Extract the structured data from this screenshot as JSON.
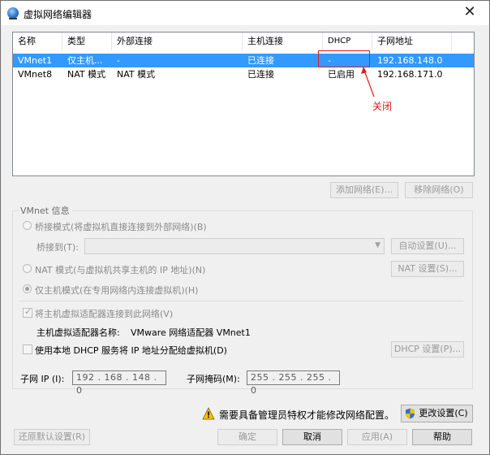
{
  "window": {
    "title": "虚拟网络编辑器",
    "close_glyph": "✕"
  },
  "table": {
    "headers": [
      "名称",
      "类型",
      "外部连接",
      "主机连接",
      "DHCP",
      "子网地址"
    ],
    "rows": [
      [
        "VMnet1",
        "仅主机...",
        "-",
        "已连接",
        "-",
        "192.168.148.0"
      ],
      [
        "VMnet8",
        "NAT 模式",
        "NAT 模式",
        "已连接",
        "已启用",
        "192.168.171.0"
      ]
    ],
    "selected_row": 0
  },
  "annotation": {
    "text": "关闭",
    "color": "#e21b1b"
  },
  "buttons": {
    "add_network": "添加网络(E)...",
    "remove_network": "移除网络(O)",
    "auto_settings": "自动设置(U)...",
    "nat_settings": "NAT 设置(S)...",
    "dhcp_settings": "DHCP 设置(P)...",
    "change_settings": "更改设置(C)",
    "restore_defaults": "还原默认设置(R)",
    "ok": "确定",
    "cancel": "取消",
    "apply": "应用(A)",
    "help": "帮助"
  },
  "vmnet_info": {
    "group_label": "VMnet 信息",
    "bridged_mode": "桥接模式(将虚拟机直接连接到外部网络)(B)",
    "bridged_to_label": "桥接到(T):",
    "bridged_to_value": "",
    "nat_mode": "NAT 模式(与虚拟机共享主机的 IP 地址)(N)",
    "host_only_mode": "仅主机模式(在专用网络内连接虚拟机)(H)",
    "selected_mode": "host-only",
    "connect_host_adapter": "将主机虚拟适配器连接到此网络(V)",
    "connect_host_adapter_checked": true,
    "adapter_name_label": "主机虚拟适配器名称:",
    "adapter_name_value": "VMware 网络适配器 VMnet1",
    "use_local_dhcp": "使用本地 DHCP 服务将 IP 地址分配给虚拟机(D)",
    "use_local_dhcp_checked": false,
    "subnet_ip_label": "子网 IP (I):",
    "subnet_ip_value": "192 . 168 . 148 .  0",
    "subnet_mask_label": "子网掩码(M):",
    "subnet_mask_value": "255 . 255 . 255 .  0"
  },
  "footer": {
    "admin_warning": "需要具备管理员特权才能修改网络配置。"
  }
}
